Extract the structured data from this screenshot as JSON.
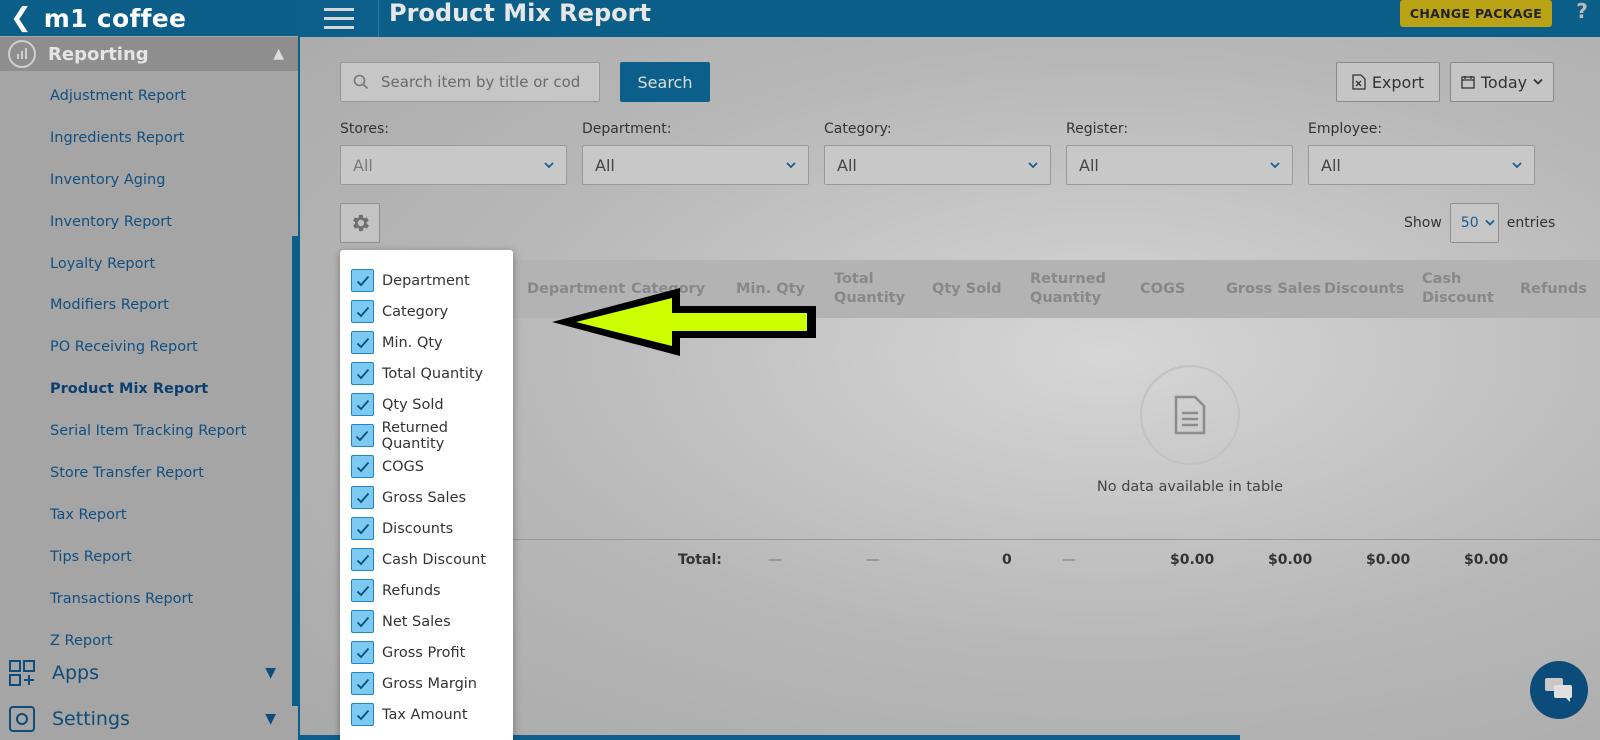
{
  "brand": {
    "name": "m1 coffee"
  },
  "sidebar": {
    "section": "Reporting",
    "items": [
      {
        "label": "Adjustment Report",
        "active": false
      },
      {
        "label": "Ingredients Report",
        "active": false
      },
      {
        "label": "Inventory Aging",
        "active": false
      },
      {
        "label": "Inventory Report",
        "active": false
      },
      {
        "label": "Loyalty Report",
        "active": false
      },
      {
        "label": "Modifiers Report",
        "active": false
      },
      {
        "label": "PO Receiving Report",
        "active": false
      },
      {
        "label": "Product Mix Report",
        "active": true
      },
      {
        "label": "Serial Item Tracking Report",
        "active": false
      },
      {
        "label": "Store Transfer Report",
        "active": false
      },
      {
        "label": "Tax Report",
        "active": false
      },
      {
        "label": "Tips Report",
        "active": false
      },
      {
        "label": "Transactions Report",
        "active": false
      },
      {
        "label": "Z Report",
        "active": false
      }
    ],
    "apps_label": "Apps",
    "settings_label": "Settings"
  },
  "header": {
    "title": "Product Mix Report",
    "change_package": "CHANGE PACKAGE",
    "help": "?"
  },
  "toolbar": {
    "search_placeholder": "Search item by title or code",
    "search_button": "Search",
    "export_label": "Export",
    "date_label": "Today"
  },
  "filters": [
    {
      "label": "Stores:",
      "value": "All"
    },
    {
      "label": "Department:",
      "value": "All"
    },
    {
      "label": "Category:",
      "value": "All"
    },
    {
      "label": "Register:",
      "value": "All"
    },
    {
      "label": "Employee:",
      "value": "All"
    }
  ],
  "entries": {
    "show": "Show",
    "value": "50",
    "suffix": "entries"
  },
  "table": {
    "headers": [
      "Department",
      "Category",
      "Min. Qty",
      "Total Quantity",
      "Qty Sold",
      "Returned Quantity",
      "COGS",
      "Gross Sales",
      "Discounts",
      "Cash Discount",
      "Refunds"
    ],
    "empty_message": "No data available in table",
    "total_label": "Total:",
    "totals": [
      "—",
      "—",
      "0",
      "—",
      "$0.00",
      "$0.00",
      "$0.00",
      "$0.00"
    ]
  },
  "column_menu": {
    "items": [
      {
        "label": "Department",
        "checked": true
      },
      {
        "label": "Category",
        "checked": true
      },
      {
        "label": "Min. Qty",
        "checked": true
      },
      {
        "label": "Total Quantity",
        "checked": true
      },
      {
        "label": "Qty Sold",
        "checked": true
      },
      {
        "label": "Returned Quantity",
        "checked": true
      },
      {
        "label": "COGS",
        "checked": true
      },
      {
        "label": "Gross Sales",
        "checked": true
      },
      {
        "label": "Discounts",
        "checked": true
      },
      {
        "label": "Cash Discount",
        "checked": true
      },
      {
        "label": "Refunds",
        "checked": true
      },
      {
        "label": "Net Sales",
        "checked": true
      },
      {
        "label": "Gross Profit",
        "checked": true
      },
      {
        "label": "Gross Margin",
        "checked": true
      },
      {
        "label": "Tax Amount",
        "checked": true
      }
    ]
  },
  "colors": {
    "brand_blue": "#0a5e88",
    "accent_yellow": "#ccff00",
    "checkbox_fill": "#7cc9f2"
  }
}
